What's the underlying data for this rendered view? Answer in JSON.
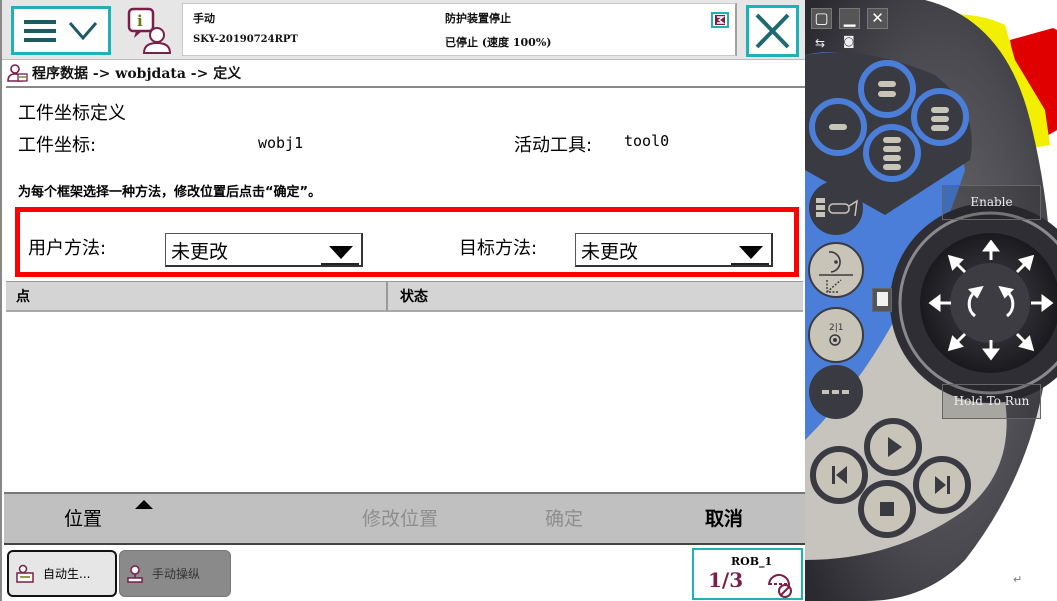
{
  "header": {
    "menu_button": "main-menu",
    "status": {
      "mode": "手动",
      "controller_name": "SKY-20190724RPT",
      "safety_state": "防护装置停止",
      "run_state": "已停止 (速度 100%)"
    }
  },
  "breadcrumb": {
    "text": "程序数据 -> wobjdata -> 定义"
  },
  "page": {
    "title": "工件坐标定义",
    "wobj_label": "工件坐标:",
    "wobj_value": "wobj1",
    "tool_label": "活动工具:",
    "tool_value": "tool0",
    "instruction": "为每个框架选择一种方法，修改位置后点击“确定”。"
  },
  "methods": {
    "user_method_label": "用户方法:",
    "user_method_value": "未更改",
    "target_method_label": "目标方法:",
    "target_method_value": "未更改",
    "highlight_color": "#ff0000"
  },
  "table": {
    "columns": [
      "点",
      "状态"
    ],
    "rows": []
  },
  "command_bar": {
    "position": "位置",
    "modify_position": "修改位置",
    "ok": "确定",
    "cancel": "取消"
  },
  "taskbar": {
    "tasks": [
      "自动生...",
      "手动操纵"
    ],
    "quickset": {
      "robot": "ROB_1",
      "speed_fraction": "1/3"
    }
  },
  "pendant": {
    "enable_label": "Enable",
    "hold_to_run_label": "Hold To Run",
    "window_buttons": [
      "restore",
      "minimize",
      "close"
    ],
    "accent_blue": "#4a7ed8",
    "estop_red": "#e00000",
    "guard_yellow": "#f2ef00"
  }
}
